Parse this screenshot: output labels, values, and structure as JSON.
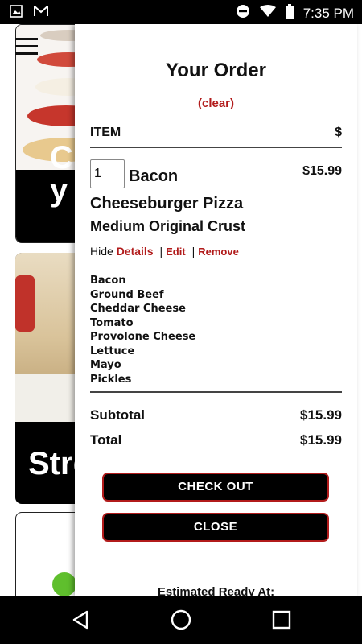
{
  "status_bar": {
    "time": "7:35 PM",
    "left_icons": [
      "image-icon",
      "gmail-icon"
    ],
    "right_icons": [
      "do-not-disturb-icon",
      "wifi-icon",
      "battery-icon"
    ]
  },
  "background": {
    "card1_text": "Cr y O",
    "card2_text": "Stre"
  },
  "order": {
    "title": "Your Order",
    "clear_label": "(clear)",
    "columns": {
      "item": "ITEM",
      "currency": "$"
    },
    "item": {
      "quantity": "1",
      "name": "Bacon Cheeseburger Pizza",
      "price": "$15.99",
      "size_crust": "Medium Original Crust",
      "hide_label": "Hide",
      "details_label": "Details",
      "edit_label": "Edit",
      "remove_label": "Remove",
      "separator": "|",
      "toppings": [
        "Bacon",
        "Ground Beef",
        "Cheddar Cheese",
        "Tomato",
        "Provolone Cheese",
        "Lettuce",
        "Mayo",
        "Pickles"
      ]
    },
    "subtotal_label": "Subtotal",
    "subtotal_value": "$15.99",
    "total_label": "Total",
    "total_value": "$15.99",
    "checkout_label": "CHECK OUT",
    "close_label": "CLOSE",
    "estimated_ready_label": "Estimated Ready At:"
  },
  "colors": {
    "accent_red": "#b21b1b",
    "button_bg": "#000000"
  },
  "nav_bar": {
    "icons": [
      "back-icon",
      "home-icon",
      "recents-icon"
    ]
  }
}
